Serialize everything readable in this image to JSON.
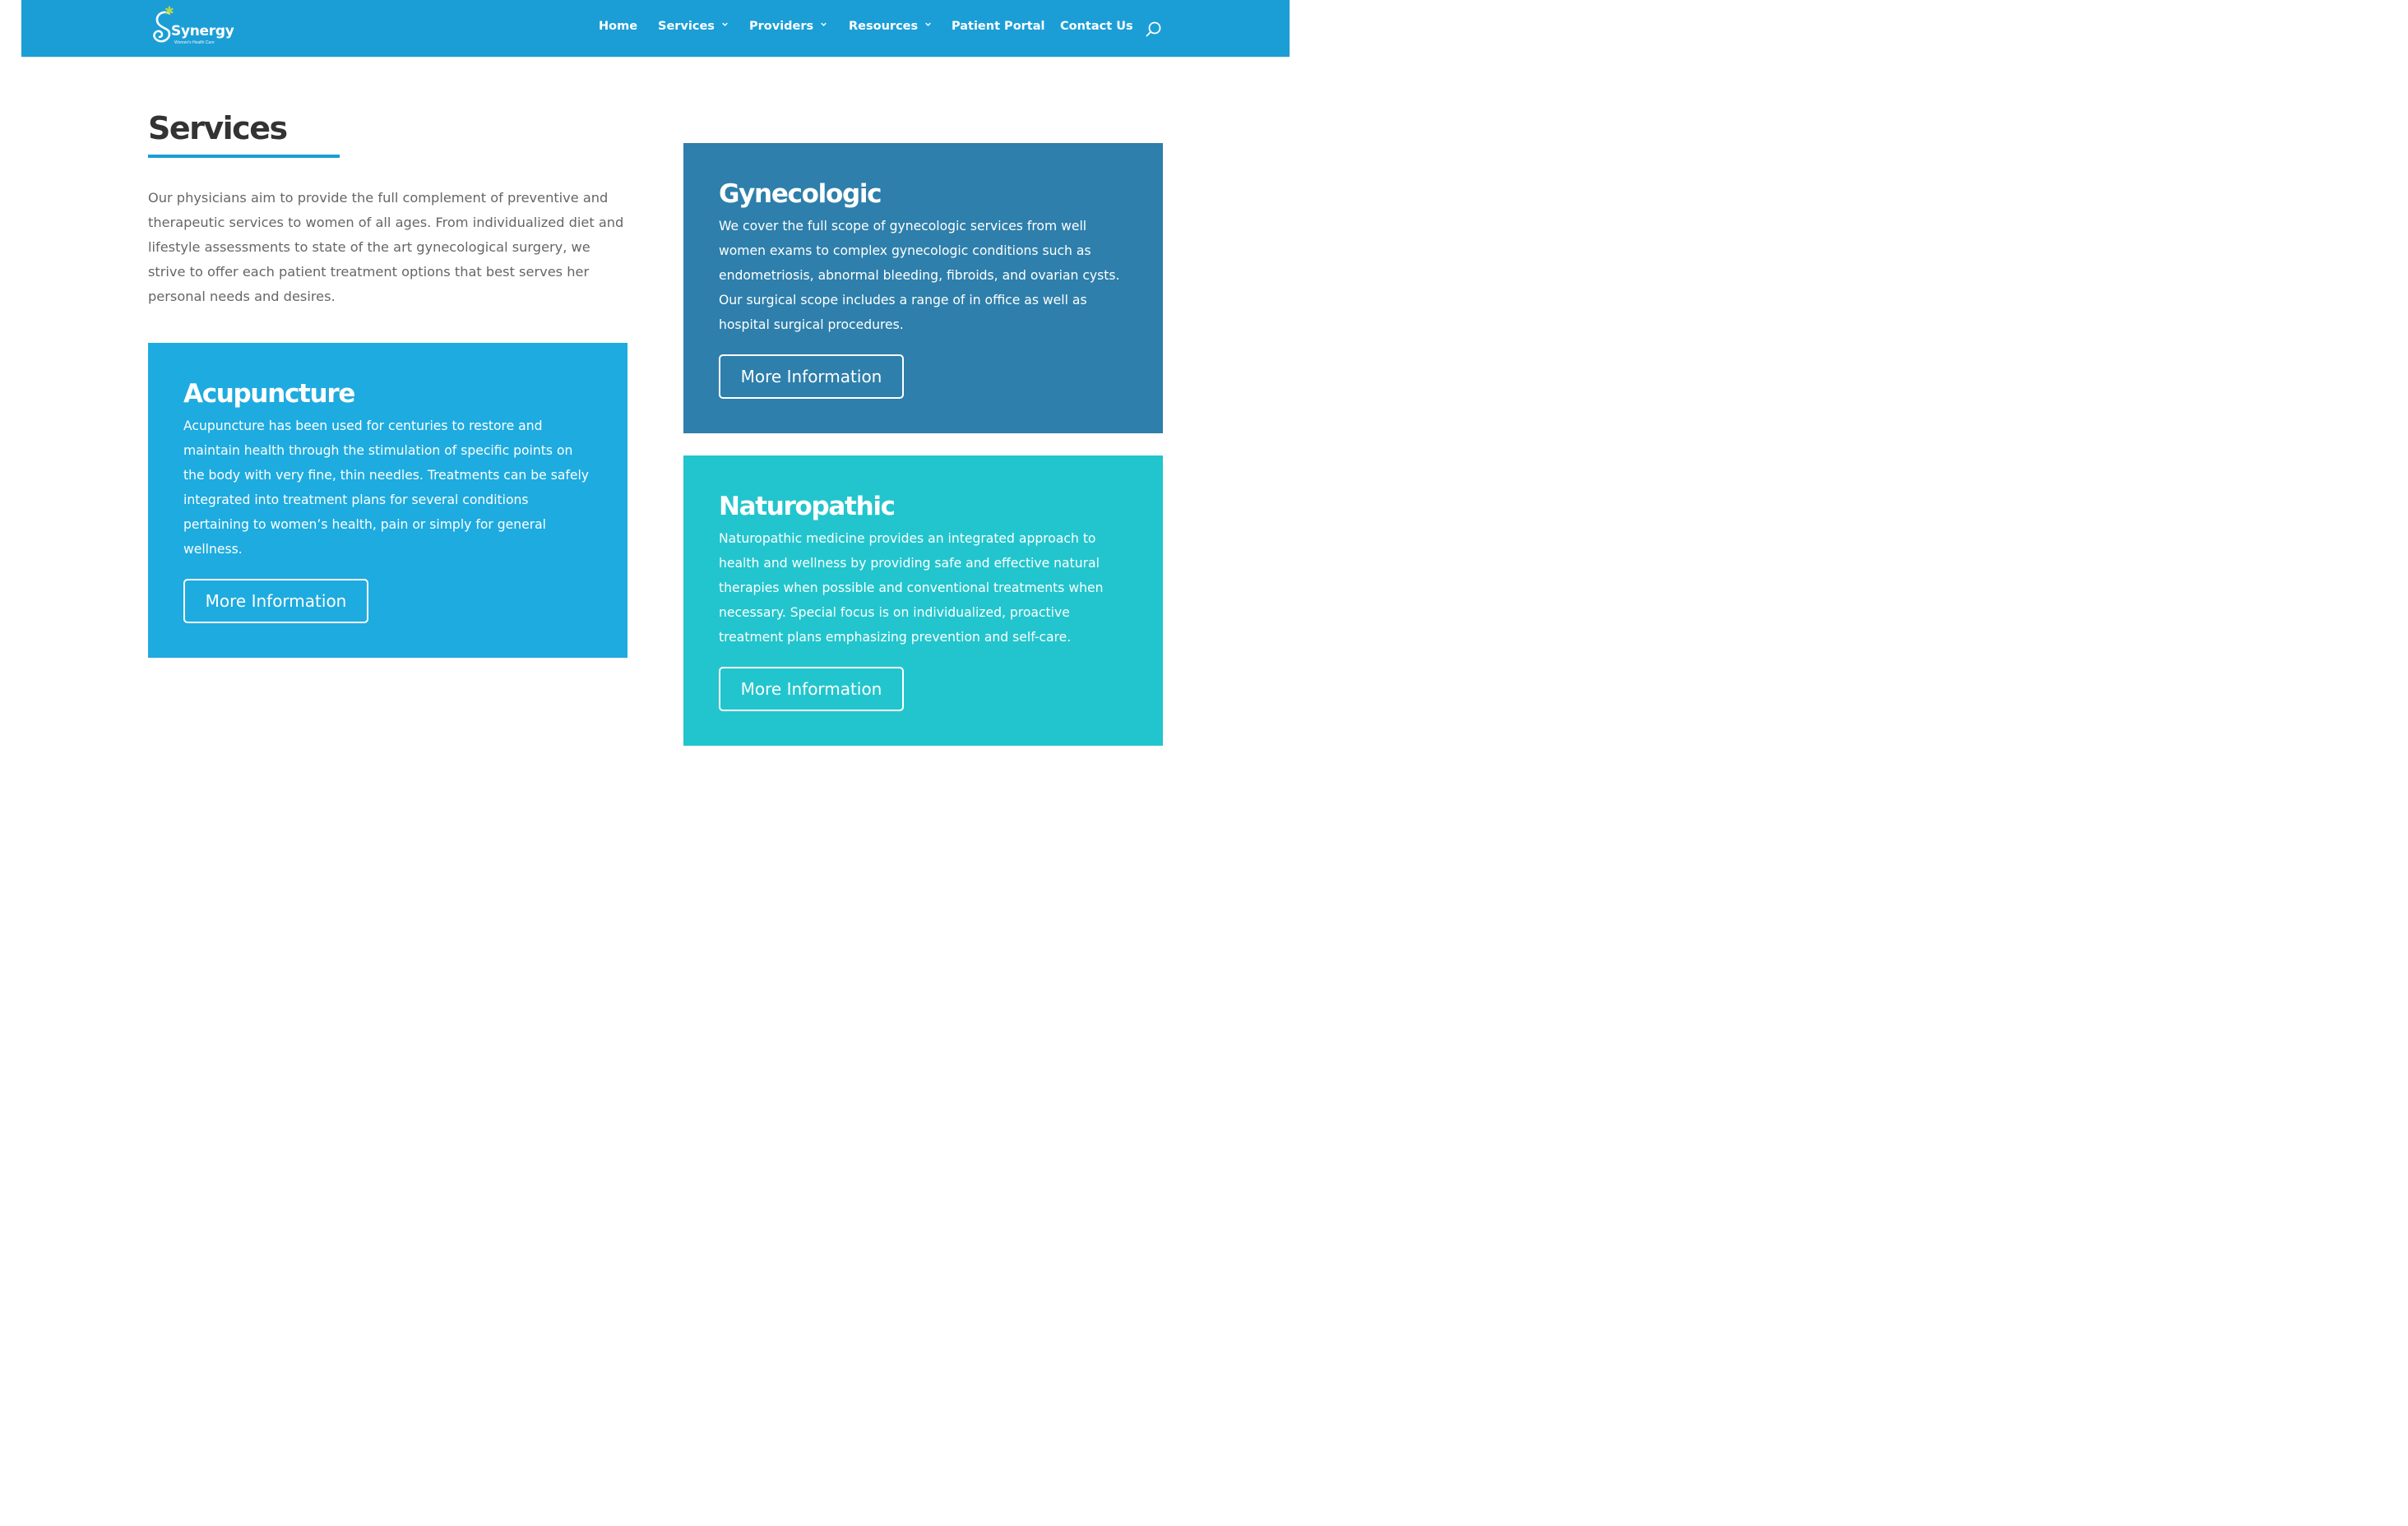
{
  "header": {
    "logo": {
      "name": "Synergy",
      "tagline": "Women's Health Care"
    },
    "nav": [
      {
        "label": "Home",
        "has_dropdown": false
      },
      {
        "label": "Services",
        "has_dropdown": true
      },
      {
        "label": "Providers",
        "has_dropdown": true
      },
      {
        "label": "Resources",
        "has_dropdown": true
      },
      {
        "label": "Patient Portal",
        "has_dropdown": false
      },
      {
        "label": "Contact Us",
        "has_dropdown": false
      }
    ],
    "search_icon": "search-icon"
  },
  "main": {
    "title": "Services",
    "intro": "Our physicians aim to provide the full complement of preventive and therapeutic services to women of all ages. From individualized diet and lifestyle assessments to state of the art gynecological surgery, we strive to offer each patient treatment options that best serves her personal needs and desires.",
    "cards": [
      {
        "title": "Acupuncture",
        "text": "Acupuncture has been used for centuries to restore and maintain health through the stimulation of specific points on the body with very fine, thin needles. Treatments can be safely integrated into treatment plans for several conditions pertaining to women’s health, pain or simply for general wellness.",
        "button": "More Information",
        "color": "#1eabdf"
      },
      {
        "title": "Gynecologic",
        "text": "We cover the full scope of gynecologic services from well women exams to complex gynecologic conditions such as endometriosis, abnormal bleeding, fibroids, and ovarian cysts. Our surgical scope includes a range of in office as well as hospital surgical procedures.",
        "button": "More Information",
        "color": "#2e7fab"
      },
      {
        "title": "Naturopathic",
        "text": "Naturopathic medicine provides an integrated approach to health and wellness by providing safe and effective natural therapies when possible and conventional treatments when necessary. Special focus is on individualized, proactive treatment plans emphasizing prevention and self-care.",
        "button": "More Information",
        "color": "#22c5cd"
      }
    ]
  },
  "colors": {
    "header": "#1b9ed6",
    "accent": "#1b9ed6",
    "title_text": "#333333",
    "body_text": "#666666"
  }
}
